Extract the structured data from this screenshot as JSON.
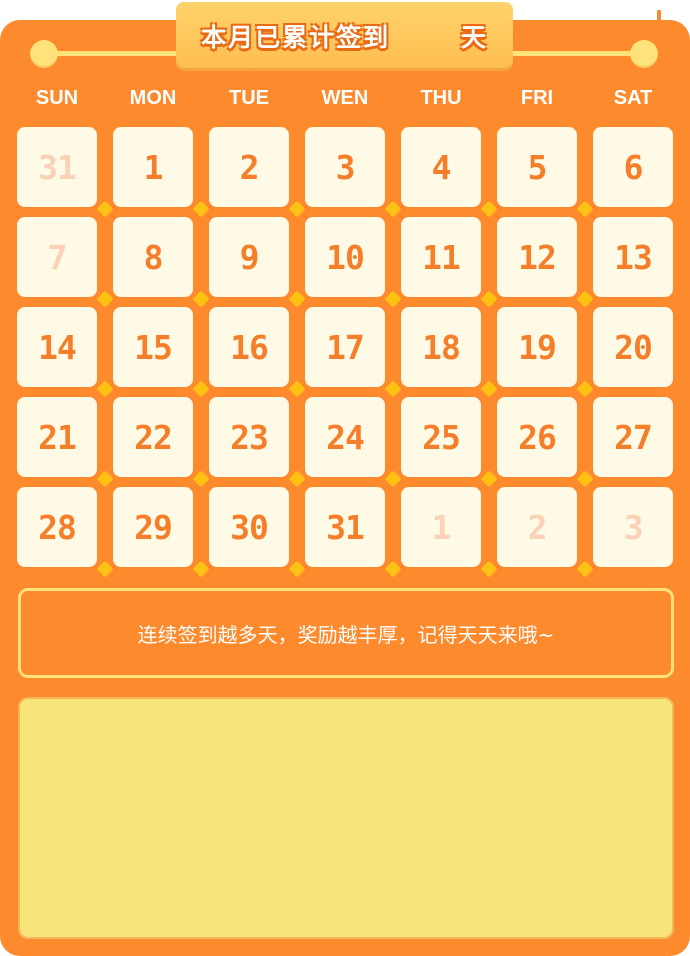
{
  "header": {
    "title": "本月已累计签到",
    "days_count": "",
    "unit": "天"
  },
  "weekdays": [
    "SUN",
    "MON",
    "TUE",
    "WEN",
    "THU",
    "FRI",
    "SAT"
  ],
  "calendar": [
    [
      {
        "day": "31",
        "other": true
      },
      {
        "day": "1",
        "other": false
      },
      {
        "day": "2",
        "other": false
      },
      {
        "day": "3",
        "other": false
      },
      {
        "day": "4",
        "other": false
      },
      {
        "day": "5",
        "other": false
      },
      {
        "day": "6",
        "other": false
      }
    ],
    [
      {
        "day": "7",
        "other": true
      },
      {
        "day": "8",
        "other": false
      },
      {
        "day": "9",
        "other": false
      },
      {
        "day": "10",
        "other": false
      },
      {
        "day": "11",
        "other": false
      },
      {
        "day": "12",
        "other": false
      },
      {
        "day": "13",
        "other": false
      }
    ],
    [
      {
        "day": "14",
        "other": false
      },
      {
        "day": "15",
        "other": false
      },
      {
        "day": "16",
        "other": false
      },
      {
        "day": "17",
        "other": false
      },
      {
        "day": "18",
        "other": false
      },
      {
        "day": "19",
        "other": false
      },
      {
        "day": "20",
        "other": false
      }
    ],
    [
      {
        "day": "21",
        "other": false
      },
      {
        "day": "22",
        "other": false
      },
      {
        "day": "23",
        "other": false
      },
      {
        "day": "24",
        "other": false
      },
      {
        "day": "25",
        "other": false
      },
      {
        "day": "26",
        "other": false
      },
      {
        "day": "27",
        "other": false
      }
    ],
    [
      {
        "day": "28",
        "other": false
      },
      {
        "day": "29",
        "other": false
      },
      {
        "day": "30",
        "other": false
      },
      {
        "day": "31",
        "other": false
      },
      {
        "day": "1",
        "other": true
      },
      {
        "day": "2",
        "other": true
      },
      {
        "day": "3",
        "other": true
      }
    ]
  ],
  "notice": "连续签到越多天，奖励越丰厚，记得天天来哦~",
  "colors": {
    "panel": "#fd8a2c",
    "cell_bg": "#fffae6",
    "day_text": "#f57e2a",
    "day_text_faded": "#fcd2b6",
    "accent_yellow": "#ffe27a",
    "reward_bg": "#f7e57c"
  }
}
